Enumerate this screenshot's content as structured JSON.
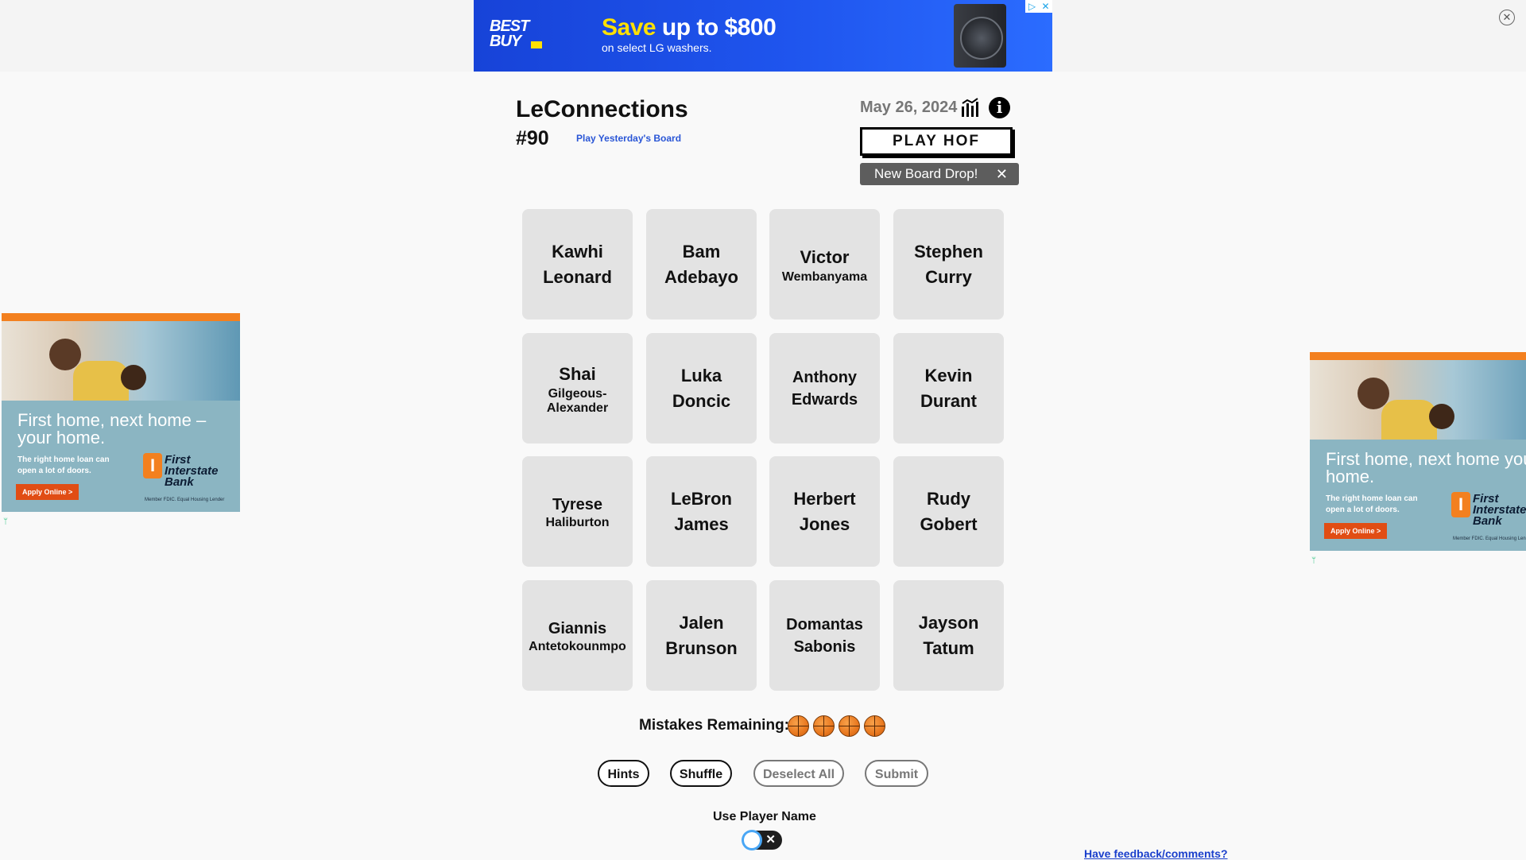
{
  "top_ad": {
    "brand_line1": "BEST",
    "brand_line2": "BUY",
    "headline_save": "Save",
    "headline_rest": " up to $800",
    "subline": "on select LG washers."
  },
  "header": {
    "title": "LeConnections",
    "board_number": "#90",
    "yesterday_link": "Play Yesterday's Board",
    "date": "May 26, 2024",
    "hof_button": "PLAY HOF",
    "drop_badge": "New Board Drop!",
    "drop_close": "✕"
  },
  "tiles": [
    {
      "line1": "Kawhi",
      "line2": "Leonard"
    },
    {
      "line1": "Bam",
      "line2": "Adebayo"
    },
    {
      "line1": "Victor",
      "line2": "Wembanyama"
    },
    {
      "line1": "Stephen",
      "line2": "Curry"
    },
    {
      "line1": "Shai",
      "line2": "Gilgeous-",
      "line3": "Alexander"
    },
    {
      "line1": "Luka",
      "line2": "Doncic"
    },
    {
      "line1": "Anthony",
      "line2": "Edwards"
    },
    {
      "line1": "Kevin",
      "line2": "Durant"
    },
    {
      "line1": "Tyrese",
      "line2": "Haliburton"
    },
    {
      "line1": "LeBron",
      "line2": "James"
    },
    {
      "line1": "Herbert",
      "line2": "Jones"
    },
    {
      "line1": "Rudy",
      "line2": "Gobert"
    },
    {
      "line1": "Giannis",
      "line2": "Antetokounmpo"
    },
    {
      "line1": "Jalen",
      "line2": "Brunson"
    },
    {
      "line1": "Domantas",
      "line2": "Sabonis"
    },
    {
      "line1": "Jayson",
      "line2": "Tatum"
    }
  ],
  "mistakes": {
    "label": "Mistakes Remaining:",
    "remaining": 4
  },
  "actions": {
    "hints": "Hints",
    "shuffle": "Shuffle",
    "deselect": "Deselect All",
    "submit": "Submit"
  },
  "toggle": {
    "label": "Use Player Name",
    "off_mark": "✕",
    "state": "off"
  },
  "feedback_link": "Have feedback/comments?",
  "side_ad": {
    "headline_left": "First home, next home – your home.",
    "headline_right": "First home, next home your home.",
    "subline": "The right home loan can open a lot of doors.",
    "button": "Apply Online >",
    "bank_name": "First Interstate Bank",
    "fine_print": "Member FDIC. Equal Housing Lender"
  },
  "colors": {
    "tile_bg": "#e3e3e3",
    "accent_link": "#2a56d6",
    "ad_blue": "#1f55ee",
    "ad_yellow": "#ffe000"
  }
}
